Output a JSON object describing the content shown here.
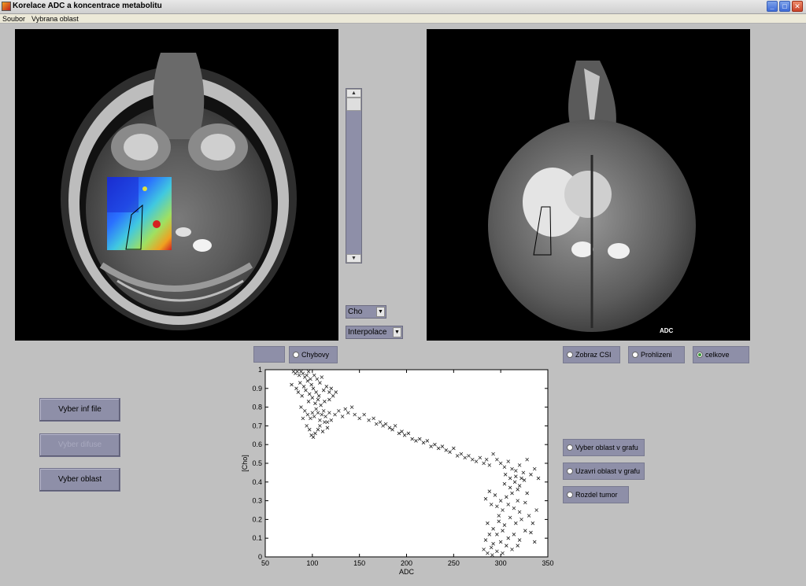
{
  "window": {
    "title": "Korelace ADC a koncentrace metabolitu",
    "buttons": [
      "_",
      "□",
      "✕"
    ]
  },
  "menu": [
    "Soubor",
    "Vybrana oblast"
  ],
  "images": {
    "left_label": "",
    "right_label": "ADC"
  },
  "controls": {
    "metabolite_select": "Cho",
    "interpolation_select": "Interpolace",
    "chybovy": "Chybovy",
    "zobraz_csi": "Zobraz CSI",
    "prohlizeni": "Prohlizeni",
    "celkove": "celkove",
    "vyber_oblast_v_grafu": "Vyber oblast v grafu",
    "uzavri_oblast_v_grafu": "Uzavri oblast v grafu",
    "rozdel_tumor": "Rozdel tumor"
  },
  "buttons": {
    "vyber_inf_file": "Vyber inf file",
    "vyber_difuse": "Vyber difuse",
    "vyber_oblast": "Vyber oblast"
  },
  "chart_data": {
    "type": "scatter",
    "xlabel": "ADC",
    "ylabel": "[Cho]",
    "xlim": [
      50,
      350
    ],
    "ylim": [
      0,
      1
    ],
    "xticks": [
      50,
      100,
      150,
      200,
      250,
      300,
      350
    ],
    "yticks": [
      0,
      0.1,
      0.2,
      0.3,
      0.4,
      0.5,
      0.6,
      0.7,
      0.8,
      0.9,
      1
    ],
    "marker": "x",
    "grid": false,
    "series": [
      {
        "points": [
          [
            80,
            0.99
          ],
          [
            82,
            0.98
          ],
          [
            84,
            0.99
          ],
          [
            86,
            0.97
          ],
          [
            88,
            0.99
          ],
          [
            90,
            0.98
          ],
          [
            92,
            0.96
          ],
          [
            94,
            0.97
          ],
          [
            96,
            0.99
          ],
          [
            98,
            0.95
          ],
          [
            78,
            0.92
          ],
          [
            83,
            0.9
          ],
          [
            87,
            0.93
          ],
          [
            91,
            0.91
          ],
          [
            95,
            0.94
          ],
          [
            99,
            0.92
          ],
          [
            102,
            0.97
          ],
          [
            105,
            0.95
          ],
          [
            108,
            0.93
          ],
          [
            110,
            0.96
          ],
          [
            85,
            0.88
          ],
          [
            89,
            0.86
          ],
          [
            93,
            0.89
          ],
          [
            97,
            0.87
          ],
          [
            101,
            0.9
          ],
          [
            104,
            0.88
          ],
          [
            107,
            0.86
          ],
          [
            112,
            0.89
          ],
          [
            115,
            0.91
          ],
          [
            118,
            0.88
          ],
          [
            120,
            0.9
          ],
          [
            122,
            0.86
          ],
          [
            125,
            0.88
          ],
          [
            118,
            0.84
          ],
          [
            113,
            0.83
          ],
          [
            109,
            0.81
          ],
          [
            106,
            0.84
          ],
          [
            103,
            0.82
          ],
          [
            100,
            0.85
          ],
          [
            96,
            0.83
          ],
          [
            88,
            0.8
          ],
          [
            92,
            0.78
          ],
          [
            95,
            0.76
          ],
          [
            98,
            0.74
          ],
          [
            100,
            0.77
          ],
          [
            102,
            0.75
          ],
          [
            104,
            0.79
          ],
          [
            106,
            0.77
          ],
          [
            108,
            0.73
          ],
          [
            110,
            0.76
          ],
          [
            112,
            0.78
          ],
          [
            114,
            0.75
          ],
          [
            116,
            0.72
          ],
          [
            118,
            0.77
          ],
          [
            90,
            0.74
          ],
          [
            94,
            0.7
          ],
          [
            97,
            0.68
          ],
          [
            99,
            0.65
          ],
          [
            101,
            0.64
          ],
          [
            103,
            0.66
          ],
          [
            106,
            0.68
          ],
          [
            108,
            0.7
          ],
          [
            111,
            0.67
          ],
          [
            113,
            0.72
          ],
          [
            116,
            0.69
          ],
          [
            120,
            0.73
          ],
          [
            124,
            0.76
          ],
          [
            128,
            0.78
          ],
          [
            132,
            0.75
          ],
          [
            135,
            0.79
          ],
          [
            138,
            0.77
          ],
          [
            142,
            0.8
          ],
          [
            145,
            0.76
          ],
          [
            150,
            0.74
          ],
          [
            155,
            0.76
          ],
          [
            160,
            0.73
          ],
          [
            165,
            0.74
          ],
          [
            168,
            0.71
          ],
          [
            172,
            0.72
          ],
          [
            175,
            0.7
          ],
          [
            178,
            0.71
          ],
          [
            182,
            0.69
          ],
          [
            185,
            0.68
          ],
          [
            188,
            0.7
          ],
          [
            192,
            0.66
          ],
          [
            195,
            0.67
          ],
          [
            198,
            0.65
          ],
          [
            202,
            0.66
          ],
          [
            206,
            0.63
          ],
          [
            210,
            0.62
          ],
          [
            214,
            0.63
          ],
          [
            218,
            0.61
          ],
          [
            222,
            0.62
          ],
          [
            226,
            0.59
          ],
          [
            230,
            0.6
          ],
          [
            234,
            0.58
          ],
          [
            238,
            0.59
          ],
          [
            242,
            0.57
          ],
          [
            246,
            0.56
          ],
          [
            250,
            0.58
          ],
          [
            254,
            0.54
          ],
          [
            258,
            0.55
          ],
          [
            262,
            0.53
          ],
          [
            266,
            0.54
          ],
          [
            270,
            0.52
          ],
          [
            274,
            0.51
          ],
          [
            278,
            0.53
          ],
          [
            282,
            0.5
          ],
          [
            285,
            0.52
          ],
          [
            288,
            0.49
          ],
          [
            292,
            0.55
          ],
          [
            296,
            0.52
          ],
          [
            300,
            0.5
          ],
          [
            304,
            0.48
          ],
          [
            308,
            0.51
          ],
          [
            312,
            0.47
          ],
          [
            316,
            0.46
          ],
          [
            320,
            0.49
          ],
          [
            324,
            0.45
          ],
          [
            328,
            0.52
          ],
          [
            332,
            0.44
          ],
          [
            336,
            0.47
          ],
          [
            340,
            0.42
          ],
          [
            305,
            0.44
          ],
          [
            310,
            0.42
          ],
          [
            315,
            0.4
          ],
          [
            320,
            0.38
          ],
          [
            325,
            0.41
          ],
          [
            318,
            0.36
          ],
          [
            312,
            0.34
          ],
          [
            306,
            0.32
          ],
          [
            300,
            0.3
          ],
          [
            294,
            0.33
          ],
          [
            288,
            0.35
          ],
          [
            284,
            0.31
          ],
          [
            290,
            0.28
          ],
          [
            296,
            0.27
          ],
          [
            302,
            0.25
          ],
          [
            308,
            0.28
          ],
          [
            314,
            0.26
          ],
          [
            320,
            0.24
          ],
          [
            326,
            0.29
          ],
          [
            330,
            0.22
          ],
          [
            322,
            0.2
          ],
          [
            316,
            0.18
          ],
          [
            310,
            0.21
          ],
          [
            304,
            0.17
          ],
          [
            298,
            0.19
          ],
          [
            292,
            0.15
          ],
          [
            286,
            0.18
          ],
          [
            296,
            0.12
          ],
          [
            302,
            0.14
          ],
          [
            308,
            0.1
          ],
          [
            314,
            0.12
          ],
          [
            320,
            0.09
          ],
          [
            326,
            0.14
          ],
          [
            332,
            0.13
          ],
          [
            336,
            0.08
          ],
          [
            300,
            0.08
          ],
          [
            306,
            0.06
          ],
          [
            312,
            0.04
          ],
          [
            318,
            0.06
          ],
          [
            290,
            0.05
          ],
          [
            296,
            0.03
          ],
          [
            302,
            0.02
          ],
          [
            284,
            0.09
          ],
          [
            288,
            0.12
          ],
          [
            292,
            0.07
          ],
          [
            298,
            0.22
          ],
          [
            318,
            0.3
          ],
          [
            322,
            0.42
          ],
          [
            316,
            0.43
          ],
          [
            310,
            0.37
          ],
          [
            304,
            0.39
          ],
          [
            328,
            0.34
          ],
          [
            334,
            0.18
          ],
          [
            338,
            0.25
          ],
          [
            282,
            0.04
          ],
          [
            286,
            0.02
          ],
          [
            291,
            0.01
          ]
        ]
      }
    ]
  }
}
